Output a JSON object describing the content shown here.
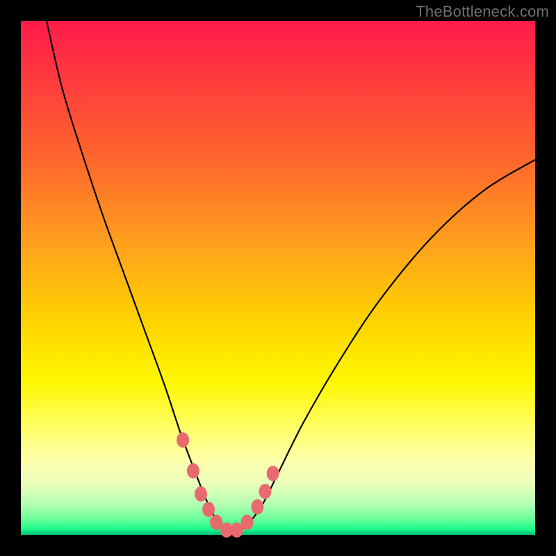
{
  "watermark": "TheBottleneck.com",
  "colors": {
    "frame_bg": "#000000",
    "curve_stroke": "#000000",
    "marker_fill": "#e86a6f",
    "marker_stroke": "#e86a6f"
  },
  "chart_data": {
    "type": "line",
    "title": "",
    "xlabel": "",
    "ylabel": "",
    "xlim": [
      0,
      100
    ],
    "ylim": [
      0,
      100
    ],
    "curve": {
      "name": "bottleneck-curve",
      "x": [
        5,
        8,
        12,
        16,
        20,
        24,
        28,
        31,
        34,
        36,
        38,
        40,
        42,
        44,
        47,
        50,
        55,
        62,
        70,
        80,
        90,
        100
      ],
      "y": [
        100,
        87,
        74,
        62,
        51,
        40,
        29,
        20,
        12,
        7,
        3,
        1,
        1,
        2,
        6,
        12,
        22,
        34,
        46,
        58,
        67,
        73
      ]
    },
    "markers": {
      "name": "highlighted-points",
      "x": [
        31.5,
        33.5,
        35.0,
        36.5,
        38.0,
        40.0,
        42.0,
        44.0,
        46.0,
        47.5,
        49.0
      ],
      "y": [
        18.5,
        12.5,
        8.0,
        5.0,
        2.5,
        1.0,
        1.0,
        2.5,
        5.5,
        8.5,
        12.0
      ]
    }
  }
}
